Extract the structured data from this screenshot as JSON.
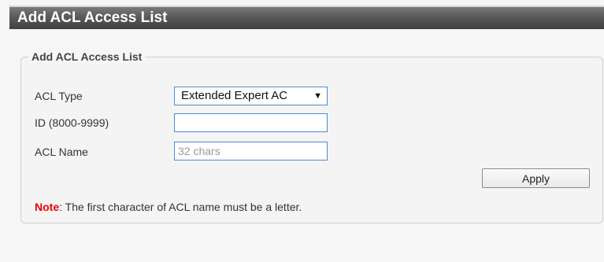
{
  "header": {
    "title": "Add ACL Access List"
  },
  "panel": {
    "legend": "Add ACL Access List",
    "fields": {
      "acl_type_label": "ACL Type",
      "acl_type_value": "Extended Expert AC",
      "id_label": "ID (8000-9999)",
      "id_value": "",
      "id_placeholder": "",
      "acl_name_label": "ACL Name",
      "acl_name_value": "",
      "acl_name_placeholder": "32 chars"
    },
    "apply_label": "Apply",
    "note_label": "Note",
    "note_text": ":  The first character of ACL name must be a letter."
  },
  "colors": {
    "header_bg": "#5a5a5a",
    "note_label": "#e60000",
    "input_border": "#4a8bd6"
  }
}
